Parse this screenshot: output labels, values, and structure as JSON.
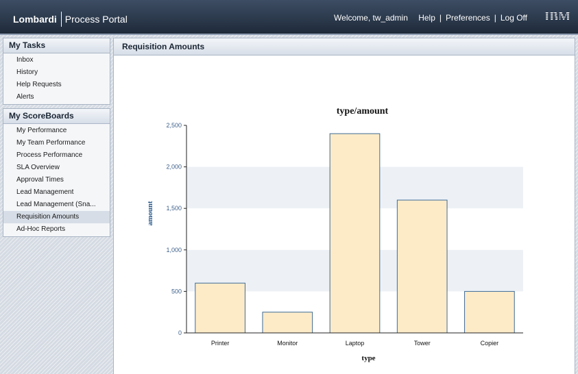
{
  "header": {
    "brand_name": "Lombardi",
    "brand_product": "Process Portal",
    "welcome": "Welcome, tw_admin",
    "help": "Help",
    "preferences": "Preferences",
    "logoff": "Log Off",
    "vendor_logo": "IBM"
  },
  "sidebar": {
    "tasks": {
      "title": "My Tasks",
      "items": [
        "Inbox",
        "History",
        "Help Requests",
        "Alerts"
      ]
    },
    "scoreboards": {
      "title": "My ScoreBoards",
      "items": [
        "My Performance",
        "My Team Performance",
        "Process Performance",
        "SLA Overview",
        "Approval Times",
        "Lead Management",
        "Lead Management (Sna...",
        "Requisition Amounts",
        "Ad-Hoc Reports"
      ],
      "active_index": 7
    }
  },
  "content": {
    "title": "Requisition Amounts"
  },
  "colors": {
    "bar_fill": "#fdebc8",
    "bar_stroke": "#3c6a96",
    "band_fill": "#edf1f6",
    "axis": "#222222"
  },
  "chart_data": {
    "type": "bar",
    "title": "type/amount",
    "xlabel": "type",
    "ylabel": "amount",
    "categories": [
      "Printer",
      "Monitor",
      "Laptop",
      "Tower",
      "Copier"
    ],
    "values": [
      600,
      250,
      2400,
      1600,
      500
    ],
    "ylim": [
      0,
      2500
    ],
    "yticks": [
      0,
      500,
      1000,
      1500,
      2000,
      2500
    ],
    "ytick_labels": [
      "0",
      "500",
      "1,000",
      "1,500",
      "2,000",
      "2,500"
    ],
    "grid": "alternating horizontal bands",
    "legend": "none"
  }
}
